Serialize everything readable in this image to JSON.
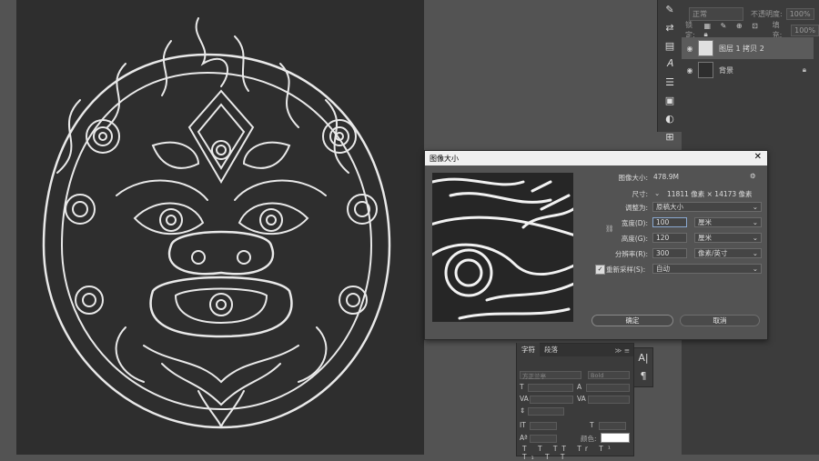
{
  "layers_panel": {
    "blend_mode": "正常",
    "opacity_label": "不透明度:",
    "opacity_value": "100%",
    "lock_label": "锁定:",
    "fill_label": "填充:",
    "fill_value": "100%",
    "layers": [
      {
        "name": "图层 1 拷贝 2",
        "selected": true
      },
      {
        "name": "背景",
        "selected": false
      }
    ]
  },
  "image_size_dialog": {
    "title": "图像大小",
    "image_size_label": "图像大小:",
    "image_size_value": "478.9M",
    "dimensions_label": "尺寸:",
    "dimensions_value": "11811 像素  ×  14173 像素",
    "fit_to_label": "调整为:",
    "fit_to_value": "原稿大小",
    "width_label": "宽度(D):",
    "width_value": "100",
    "width_unit": "厘米",
    "height_label": "高度(G):",
    "height_value": "120",
    "height_unit": "厘米",
    "resolution_label": "分辨率(R):",
    "resolution_value": "300",
    "resolution_unit": "像素/英寸",
    "resample_label": "重新采样(S):",
    "resample_checked": true,
    "resample_value": "自动",
    "ok_label": "确定",
    "cancel_label": "取消"
  },
  "character_panel": {
    "tabs": [
      "字符",
      "段落"
    ],
    "font_family": "方正兰亭",
    "font_style": "Bold",
    "color_label": "颜色:"
  },
  "icons": {
    "eye": "eye-icon",
    "lock": "lock-icon",
    "close": "close-icon",
    "gear": "gear-icon",
    "link": "chain-link-icon"
  }
}
